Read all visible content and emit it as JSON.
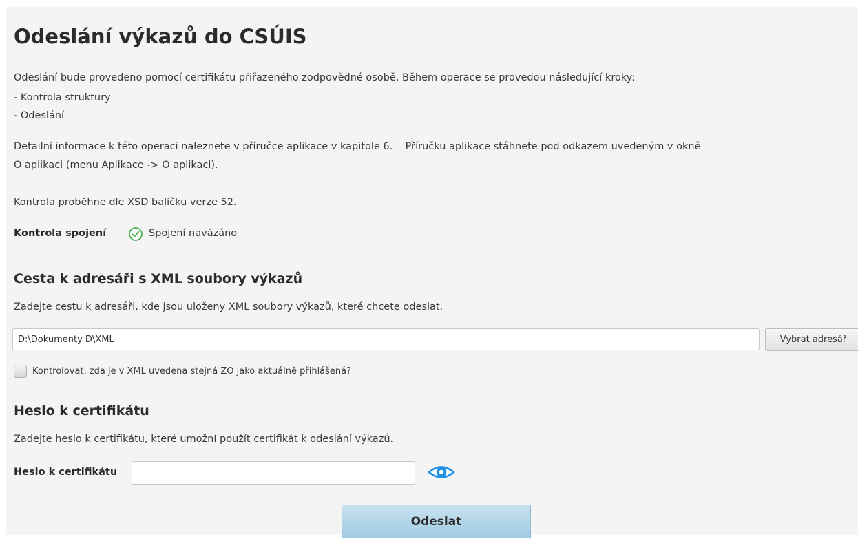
{
  "page": {
    "title": "Odeslání výkazů do CSÚIS",
    "intro": "Odeslání bude provedeno pomocí certifikátu přiřazeného zodpovědné osobě. Během operace se provedou následující kroky:",
    "steps": [
      "- Kontrola struktury",
      "- Odeslání"
    ],
    "info_line1": "Detailní informace k této operaci naleznete v příručce aplikace v kapitole 6.    Příručku aplikace stáhnete pod odkazem uvedeným v okně",
    "info_line2": "O aplikaci (menu Aplikace -> O aplikaci).",
    "xsd_note": "Kontrola proběhne dle XSD balíčku verze 52."
  },
  "connection": {
    "label": "Kontrola spojení",
    "status_icon": "check-circle-icon",
    "status_text": "Spojení navázáno",
    "status_color": "#4caf50"
  },
  "directory": {
    "heading": "Cesta k adresáři s XML soubory výkazů",
    "description": "Zadejte cestu k adresáři, kde jsou uloženy XML soubory výkazů, které chcete odeslat.",
    "path_value": "D:\\Dokumenty D\\XML",
    "browse_label": "Vybrat adresář",
    "check_zo_label": "Kontrolovat, zda je v XML uvedena stejná ZO jako aktuálně přihlášená?",
    "check_zo_checked": false
  },
  "certificate": {
    "heading": "Heslo k certifikátu",
    "description": "Zadejte heslo k certifikátu, které umožní použít certifikát k odeslání výkazů.",
    "password_label": "Heslo k certifikátu",
    "password_value": "",
    "reveal_icon": "eye-icon"
  },
  "actions": {
    "submit_label": "Odeslat"
  },
  "colors": {
    "panel_bg": "#f4f4f4",
    "eye_blue": "#1e90e6",
    "submit_blue": "#b7d8ea"
  }
}
